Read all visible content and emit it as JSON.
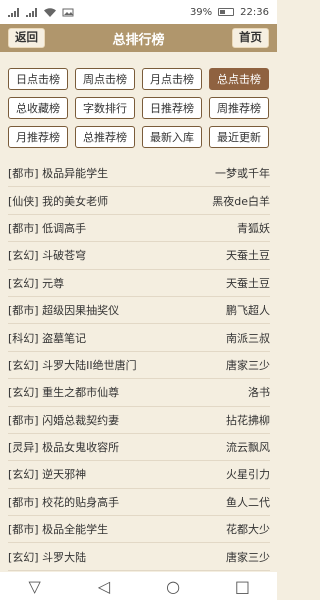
{
  "status": {
    "battery": "39%",
    "time": "22:36"
  },
  "header": {
    "title": "总排行榜",
    "back_label": "返回",
    "home_label": "首页"
  },
  "categories": [
    {
      "label": "日点击榜",
      "active": false
    },
    {
      "label": "周点击榜",
      "active": false
    },
    {
      "label": "月点击榜",
      "active": false
    },
    {
      "label": "总点击榜",
      "active": true
    },
    {
      "label": "总收藏榜",
      "active": false
    },
    {
      "label": "字数排行",
      "active": false
    },
    {
      "label": "日推荐榜",
      "active": false
    },
    {
      "label": "周推荐榜",
      "active": false
    },
    {
      "label": "月推荐榜",
      "active": false
    },
    {
      "label": "总推荐榜",
      "active": false
    },
    {
      "label": "最新入库",
      "active": false
    },
    {
      "label": "最近更新",
      "active": false
    }
  ],
  "books": [
    {
      "title": "[都市] 极品异能学生",
      "author": "一梦或千年"
    },
    {
      "title": "[仙侠] 我的美女老师",
      "author": "黑夜de白羊"
    },
    {
      "title": "[都市] 低调高手",
      "author": "青狐妖"
    },
    {
      "title": "[玄幻] 斗破苍穹",
      "author": "天蚕土豆"
    },
    {
      "title": "[玄幻] 元尊",
      "author": "天蚕土豆"
    },
    {
      "title": "[都市] 超级因果抽奖仪",
      "author": "鹏飞超人"
    },
    {
      "title": "[科幻] 盗墓笔记",
      "author": "南派三叔"
    },
    {
      "title": "[玄幻] 斗罗大陆II绝世唐门",
      "author": "唐家三少"
    },
    {
      "title": "[玄幻] 重生之都市仙尊",
      "author": "洛书"
    },
    {
      "title": "[都市] 闪婚总裁契约妻",
      "author": "拈花拂柳"
    },
    {
      "title": "[灵异] 极品女鬼收容所",
      "author": "流云飘风"
    },
    {
      "title": "[玄幻] 逆天邪神",
      "author": "火星引力"
    },
    {
      "title": "[都市] 校花的贴身高手",
      "author": "鱼人二代"
    },
    {
      "title": "[都市] 极品全能学生",
      "author": "花都大少"
    },
    {
      "title": "[玄幻] 斗罗大陆",
      "author": "唐家三少"
    }
  ],
  "nav": {
    "back_icon": "▽",
    "home_icon": "◁",
    "circle_icon": "○",
    "recent_icon": "□"
  }
}
